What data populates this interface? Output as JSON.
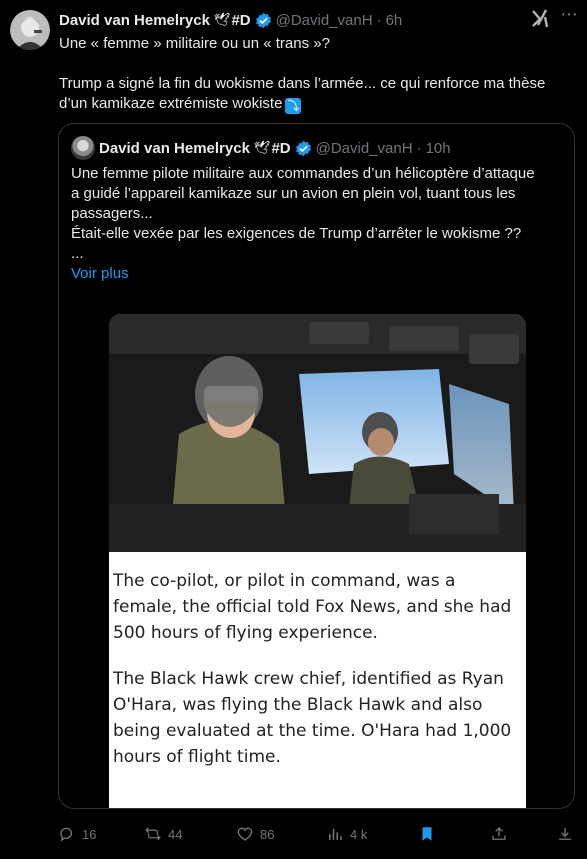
{
  "tweet": {
    "author_name": "David van Hemelryck",
    "author_emoji": "🕊",
    "author_tag": "#D",
    "handle": "@David_vanH",
    "time": "6h",
    "text": "Une « femme » militaire ou un « trans »?\n\nTrump a signé la fin du wokisme dans l’armée... ce qui renforce ma thèse\nd’un kamikaze extrémiste wokiste",
    "arrow_emoji": "⤵"
  },
  "quote": {
    "author_name": "David van Hemelryck",
    "author_emoji": "🕊",
    "author_tag": "#D",
    "handle": "@David_vanH",
    "time": "10h",
    "text": "Une femme pilote militaire aux commandes d’un hélicoptère d’attaque\na guidé l’appareil kamikaze sur un avion en plein vol, tuant tous les\npassagers...\nÉtait-elle vexée par les exigences de Trump d’arrêter le wokisme ??\n...",
    "show_more": "Voir plus",
    "media_text_1": "The co-pilot, or pilot in command, was a female, the official told Fox News, and she had 500 hours of flying experience.",
    "media_text_2": "The Black Hawk crew chief, identified as Ryan O'Hara, was flying the Black Hawk and also being evaluated at the time. O'Hara had 1,000 hours of flight time."
  },
  "actions": {
    "replies": "16",
    "reposts": "44",
    "likes": "86",
    "views": "4 k"
  },
  "colors": {
    "accent": "#1d9bf0",
    "muted": "#71767b",
    "text": "#e7e9ea",
    "background": "#000000"
  }
}
